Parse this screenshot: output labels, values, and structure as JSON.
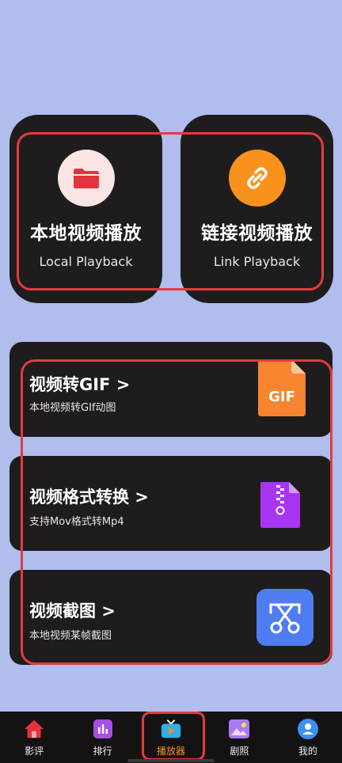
{
  "playback": {
    "local": {
      "title": "本地视频播放",
      "subtitle": "Local Playback",
      "icon": "folder-icon"
    },
    "link": {
      "title": "链接视频播放",
      "subtitle": "Link Playback",
      "icon": "link-icon"
    }
  },
  "tools": [
    {
      "title": "视频转GIF >",
      "desc": "本地视频转GIf动图",
      "icon": "gif-file-icon",
      "icon_text": "GIF"
    },
    {
      "title": "视频格式转换 >",
      "desc": "支持Mov格式转Mp4",
      "icon": "zip-file-icon"
    },
    {
      "title": "视频截图 >",
      "desc": "本地视频某帧截图",
      "icon": "scissors-icon"
    }
  ],
  "nav": {
    "items": [
      {
        "label": "影评",
        "icon": "home-icon",
        "active": false
      },
      {
        "label": "排行",
        "icon": "chart-icon",
        "active": false
      },
      {
        "label": "播放器",
        "icon": "tv-play-icon",
        "active": true
      },
      {
        "label": "剧照",
        "icon": "photo-icon",
        "active": false
      },
      {
        "label": "我的",
        "icon": "user-icon",
        "active": false
      }
    ]
  },
  "colors": {
    "background": "#b0bded",
    "card": "#1f1c1d",
    "highlight": "#e23c40",
    "active_nav": "#f48b2d",
    "gif_orange": "#f7852f",
    "zip_purple": "#a735f2",
    "scissors_blue": "#4f7cf0"
  }
}
